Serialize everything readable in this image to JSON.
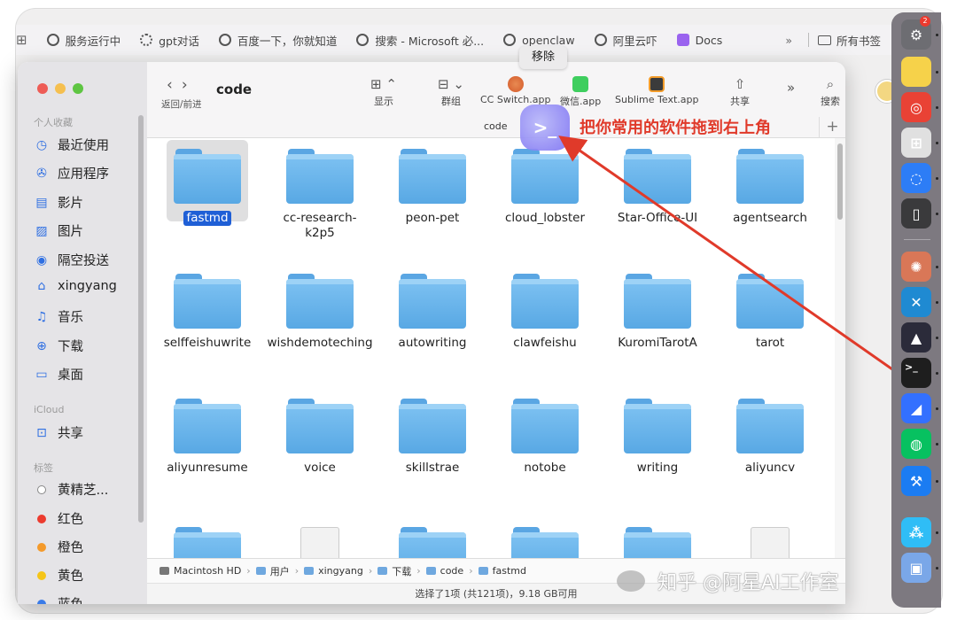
{
  "bookmarks": {
    "items": [
      {
        "label": "服务运行中",
        "icon": "globe-icon"
      },
      {
        "label": "gpt对话",
        "icon": "openai-icon"
      },
      {
        "label": "百度一下，你就知道",
        "icon": "globe-icon"
      },
      {
        "label": "搜索 - Microsoft 必...",
        "icon": "globe-icon"
      },
      {
        "label": "openclaw",
        "icon": "globe-icon"
      },
      {
        "label": "阿里云吓",
        "icon": "globe-icon"
      },
      {
        "label": "Docs",
        "icon": "docs-icon"
      }
    ],
    "more": "»",
    "all_bookmarks": "所有书签"
  },
  "finder": {
    "title": "code",
    "nav_label": "返回/前进",
    "toolbar": {
      "view": "显示",
      "group": "群组",
      "cc_switch": "CC Switch.app",
      "wechat": "微信.app",
      "sublime": "Sublime Text.app",
      "share": "共享",
      "more": "»",
      "search": "搜索"
    },
    "tab_label": "code",
    "sidebar": {
      "favorites_header": "个人收藏",
      "favorites": [
        {
          "label": "最近使用",
          "icon": "clock-icon"
        },
        {
          "label": "应用程序",
          "icon": "apps-icon"
        },
        {
          "label": "影片",
          "icon": "film-icon"
        },
        {
          "label": "图片",
          "icon": "photo-icon"
        },
        {
          "label": "隔空投送",
          "icon": "airdrop-icon"
        },
        {
          "label": "xingyang",
          "icon": "home-icon"
        },
        {
          "label": "音乐",
          "icon": "music-icon"
        },
        {
          "label": "下载",
          "icon": "download-icon"
        },
        {
          "label": "桌面",
          "icon": "desktop-icon"
        }
      ],
      "icloud_header": "iCloud",
      "icloud": [
        {
          "label": "共享",
          "icon": "shared-folder-icon"
        }
      ],
      "tags_header": "标签",
      "tags": [
        {
          "label": "黄精芝...",
          "color": "#ffffff"
        },
        {
          "label": "红色",
          "color": "#ec3b2f"
        },
        {
          "label": "橙色",
          "color": "#f49a2b"
        },
        {
          "label": "黄色",
          "color": "#f5c518"
        },
        {
          "label": "蓝色",
          "color": "#3a7be8"
        }
      ]
    },
    "folders": [
      "fastmd",
      "cc-research-\nk2p5",
      "peon-pet",
      "cloud_lobster",
      "Star-Office-UI",
      "agentsearch",
      "selffeishuwrite",
      "wishdemoteching",
      "autowriting",
      "clawfeishu",
      "KuromiTarotA",
      "tarot",
      "aliyunresume",
      "voice",
      "skillstrae",
      "notobe",
      "writing",
      "aliyuncv"
    ],
    "selected_folder": "fastmd",
    "path": [
      "Macintosh HD",
      "用户",
      "xingyang",
      "下载",
      "code",
      "fastmd"
    ],
    "status": "选择了1项 (共121项)，9.18 GB可用"
  },
  "tooltip": "移除",
  "annotation": "把你常用的软件拖到右上角",
  "drag_icon_glyph": ">_",
  "dock": {
    "badge": "2",
    "items": [
      {
        "icon": "system-settings-icon",
        "color": "#6d6d72"
      },
      {
        "icon": "notes-icon",
        "color": "#f6d24a"
      },
      {
        "icon": "chrome-icon",
        "color": "#e94235"
      },
      {
        "icon": "launchpad-icon",
        "color": "#e0e0e0"
      },
      {
        "icon": "chat-bubble-icon",
        "color": "#2d7df6"
      },
      {
        "icon": "iphone-mirroring-icon",
        "color": "#3a3a3c"
      },
      {
        "icon": "claude-icon",
        "color": "#d97757"
      },
      {
        "icon": "vscode-icon",
        "color": "#1f8ad2"
      },
      {
        "icon": "arc-icon",
        "color": "#2b2b3a"
      },
      {
        "icon": "terminal-icon",
        "color": "#1e1e1e"
      },
      {
        "icon": "feishu-icon",
        "color": "#3370ff"
      },
      {
        "icon": "wechat-icon",
        "color": "#07c160"
      },
      {
        "icon": "xcode-icon",
        "color": "#1b7cf2"
      },
      {
        "icon": "trae-icon",
        "color": "#2fbdf6"
      },
      {
        "icon": "preview-icon",
        "color": "#7aa7e8"
      }
    ]
  },
  "watermark": "知乎 @阿星AI工作室",
  "colors": {
    "accent": "#1f5fd6",
    "folder": "#6cb4ec",
    "annotation": "#e03a2a"
  }
}
